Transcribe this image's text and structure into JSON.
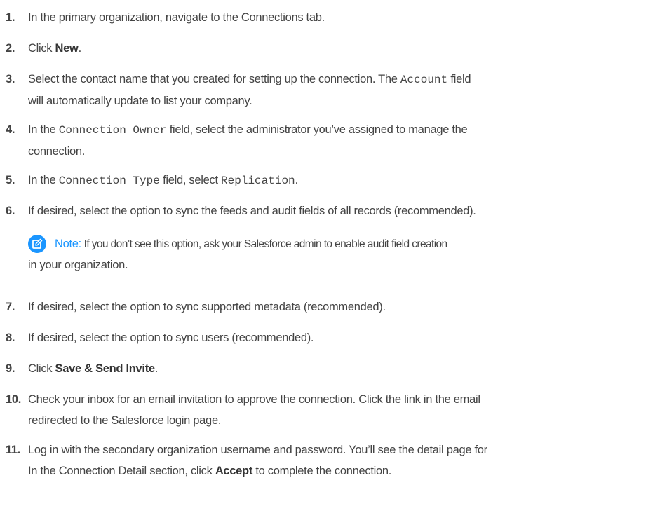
{
  "steps": [
    {
      "num": "1.",
      "text": "In the primary organization, navigate to the Connections tab."
    },
    {
      "num": "2.",
      "pre": "Click ",
      "bold": "New",
      "post": "."
    },
    {
      "num": "3.",
      "pre": "Select the contact name that you created for setting up the connection. The ",
      "code": "Account",
      "post": " field",
      "line2": "will automatically update to list your company."
    },
    {
      "num": "4.",
      "pre": "In the ",
      "code": "Connection Owner",
      "post": " field, select the administrator you’ve assigned to manage the",
      "line2": "connection."
    },
    {
      "num": "5.",
      "pre": "In the ",
      "code": "Connection Type",
      "mid": " field, select ",
      "code2": "Replication",
      "post": "."
    },
    {
      "num": "6.",
      "text": "If desired, select the option to sync the feeds and audit fields of all records (recommended)."
    },
    {
      "num": "7.",
      "text": "If desired, select the option to sync supported metadata (recommended)."
    },
    {
      "num": "8.",
      "text": "If desired, select the option to sync users (recommended)."
    },
    {
      "num": "9.",
      "pre": "Click ",
      "bold": "Save & Send Invite",
      "post": "."
    },
    {
      "num": "10.",
      "text": "Check your inbox for an email invitation to approve the connection. Click the link in the email",
      "line2": "redirected to the Salesforce login page."
    },
    {
      "num": "11.",
      "text": "Log in with the secondary organization username and password. You’ll see the detail page for",
      "pre2": "In the Connection Detail section, click ",
      "bold2": "Accept",
      "post2": " to complete the connection."
    }
  ],
  "note": {
    "label": "Note:",
    "text": " If you don’t see this option, ask your Salesforce admin to enable audit field creation",
    "line2": "in your organization.",
    "icon": "edit-note-icon",
    "accent": "#1b96ff"
  }
}
